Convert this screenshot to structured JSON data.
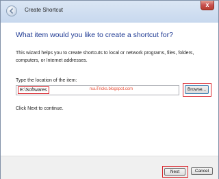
{
  "window": {
    "title": "Create Shortcut",
    "close_label": "x"
  },
  "main": {
    "heading": "What item would you like to create a shortcut for?",
    "description": "This wizard helps you to create shortcuts to local or network programs, files, folders, computers, or Internet addresses.",
    "location_label": "Type the location of the item:",
    "location_value": "E:\\Softwares",
    "browse_label": "Browse...",
    "continue_text": "Click Next to continue.",
    "watermark": "nuuTricks.blogspot.com"
  },
  "footer": {
    "next_label": "Next",
    "cancel_label": "Cancel"
  },
  "colors": {
    "heading": "#1f3a93",
    "highlight": "#d9232a",
    "watermark": "#e8503a"
  },
  "icons": {
    "back": "back-arrow-icon"
  }
}
